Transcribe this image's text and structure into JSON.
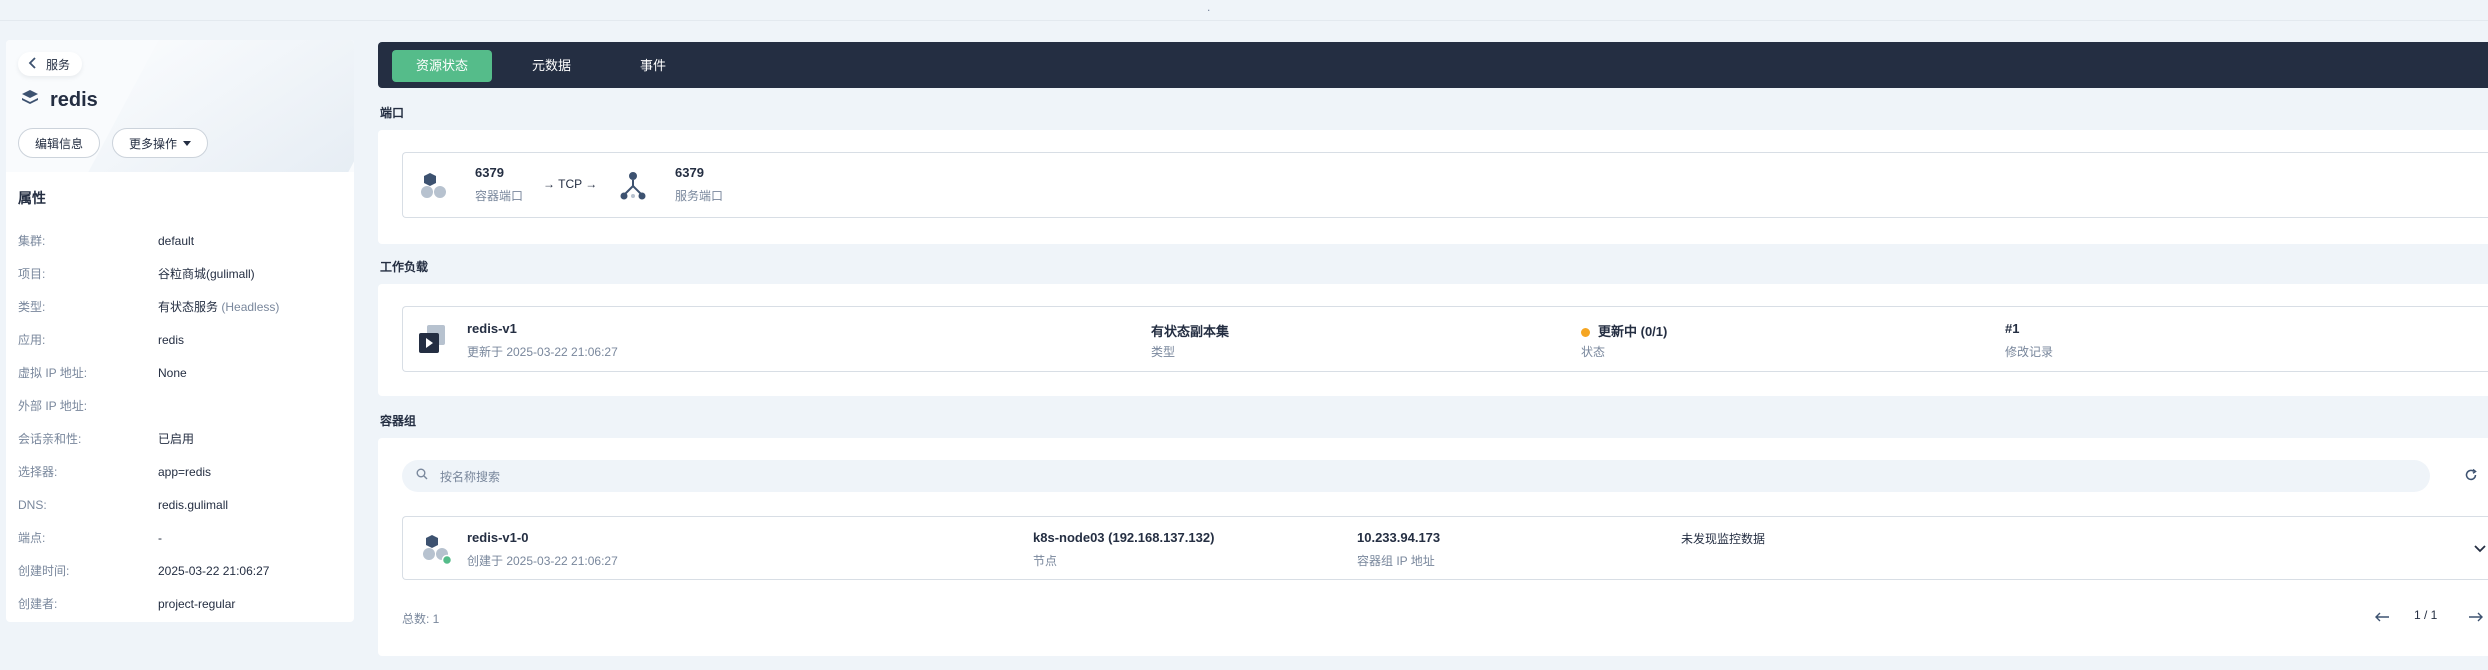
{
  "top": {
    "dot": "."
  },
  "left": {
    "back_label": "服务",
    "service_name": "redis",
    "buttons": {
      "edit": "编辑信息",
      "more": "更多操作"
    },
    "props_title": "属性",
    "props": [
      {
        "k": "集群:",
        "v": "default"
      },
      {
        "k": "项目:",
        "v": "谷粒商城(gulimall)"
      },
      {
        "k": "类型:",
        "v": "有状态服务",
        "v2": "(Headless)"
      },
      {
        "k": "应用:",
        "v": "redis"
      },
      {
        "k": "虚拟 IP 地址:",
        "v": "None"
      },
      {
        "k": "外部 IP 地址:",
        "v": ""
      },
      {
        "k": "会话亲和性:",
        "v": "已启用"
      },
      {
        "k": "选择器:",
        "v": "app=redis"
      },
      {
        "k": "DNS:",
        "v": "redis.gulimall"
      },
      {
        "k": "端点:",
        "v": "-"
      },
      {
        "k": "创建时间:",
        "v": "2025-03-22 21:06:27"
      },
      {
        "k": "创建者:",
        "v": "project-regular"
      }
    ]
  },
  "tabs": [
    "资源状态",
    "元数据",
    "事件"
  ],
  "ports": {
    "title": "端口",
    "container_port": "6379",
    "container_port_label": "容器端口",
    "protocol": "→ TCP →",
    "service_port": "6379",
    "service_port_label": "服务端口"
  },
  "workload": {
    "title": "工作负载",
    "name": "redis-v1",
    "updated": "更新于 2025-03-22 21:06:27",
    "type_value": "有状态副本集",
    "type_label": "类型",
    "status_value": "更新中 (0/1)",
    "status_label": "状态",
    "revision_value": "#1",
    "revision_label": "修改记录"
  },
  "pods": {
    "title": "容器组",
    "search_placeholder": "按名称搜索",
    "pod_name": "redis-v1-0",
    "pod_created": "创建于 2025-03-22 21:06:27",
    "node_value": "k8s-node03  (192.168.137.132)",
    "node_label": "节点",
    "ip_value": "10.233.94.173",
    "ip_label": "容器组 IP 地址",
    "monitor": "未发现监控数据",
    "total": "总数: 1",
    "page": "1 / 1"
  },
  "colors": {
    "accent": "#55bc8a",
    "dark": "#242e42",
    "warning": "#f5a623"
  }
}
